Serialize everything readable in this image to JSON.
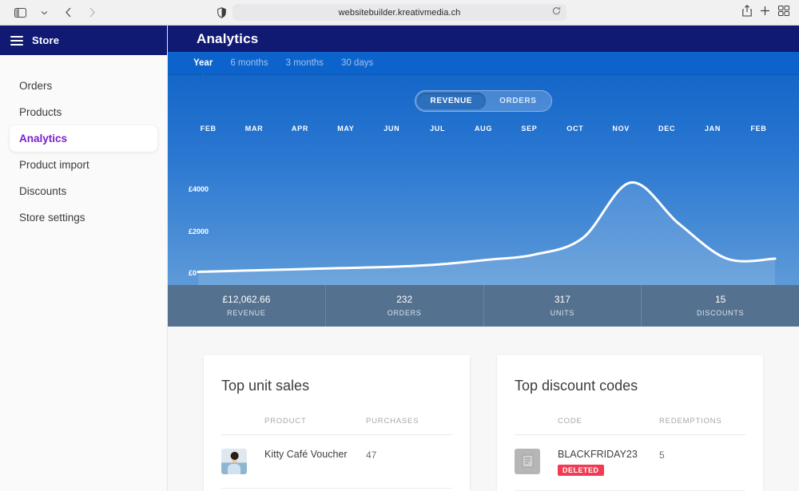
{
  "browser": {
    "url": "websitebuilder.kreativmedia.ch",
    "sidebar_toggle_icon": "sidebar-toggle-icon",
    "dropdown_icon": "chevron-down-icon",
    "back_icon": "back-arrow-icon",
    "forward_icon": "forward-arrow-icon",
    "shield_icon": "privacy-shield-icon",
    "reload_icon": "reload-icon",
    "share_icon": "share-icon",
    "new_tab_icon": "plus-icon",
    "tab_overview_icon": "tab-overview-icon"
  },
  "sidebar": {
    "store_label": "Store",
    "items": [
      {
        "label": "Orders",
        "active": false
      },
      {
        "label": "Products",
        "active": false
      },
      {
        "label": "Analytics",
        "active": true
      },
      {
        "label": "Product import",
        "active": false
      },
      {
        "label": "Discounts",
        "active": false
      },
      {
        "label": "Store settings",
        "active": false
      }
    ]
  },
  "header": {
    "title": "Analytics"
  },
  "tabs": [
    {
      "label": "Year",
      "active": true
    },
    {
      "label": "6 months",
      "active": false
    },
    {
      "label": "3 months",
      "active": false
    },
    {
      "label": "30 days",
      "active": false
    }
  ],
  "metric_toggle": {
    "options": [
      {
        "label": "REVENUE",
        "active": true
      },
      {
        "label": "ORDERS",
        "active": false
      }
    ]
  },
  "chart_data": {
    "type": "area",
    "title": "Revenue",
    "xlabel": "",
    "ylabel": "",
    "categories": [
      "FEB",
      "MAR",
      "APR",
      "MAY",
      "JUN",
      "JUL",
      "AUG",
      "SEP",
      "OCT",
      "NOV",
      "DEC",
      "JAN",
      "FEB"
    ],
    "values": [
      60,
      120,
      180,
      240,
      300,
      420,
      640,
      900,
      1700,
      4400,
      2400,
      700,
      700
    ],
    "ylim": [
      0,
      5200
    ],
    "yticks": [
      0,
      2000,
      4000
    ],
    "ytick_labels": [
      "£0",
      "£2000",
      "£4000"
    ],
    "grid": false,
    "line_color": "#ffffff",
    "fill_color": "rgba(255,255,255,0.12)",
    "legend": "none"
  },
  "stats": [
    {
      "value": "£12,062.66",
      "label": "REVENUE"
    },
    {
      "value": "232",
      "label": "ORDERS"
    },
    {
      "value": "317",
      "label": "UNITS"
    },
    {
      "value": "15",
      "label": "DISCOUNTS"
    }
  ],
  "cards": {
    "unit_sales": {
      "title": "Top unit sales",
      "columns": [
        "PRODUCT",
        "PURCHASES"
      ],
      "rows": [
        {
          "name": "Kitty Café Voucher",
          "value": "47",
          "thumb": "product-photo"
        }
      ]
    },
    "discount_codes": {
      "title": "Top discount codes",
      "columns": [
        "CODE",
        "REDEMPTIONS"
      ],
      "rows": [
        {
          "name": "BLACKFRIDAY23",
          "value": "5",
          "badge": "DELETED",
          "thumb": "document-icon"
        }
      ]
    }
  },
  "colors": {
    "brand_navy": "#101a73",
    "tabbar_blue": "#0d63cc",
    "accent_purple": "#7b1fd1",
    "indicator_green": "#2fb88a",
    "stats_slate": "#54718f",
    "badge_red": "#f23b52"
  }
}
